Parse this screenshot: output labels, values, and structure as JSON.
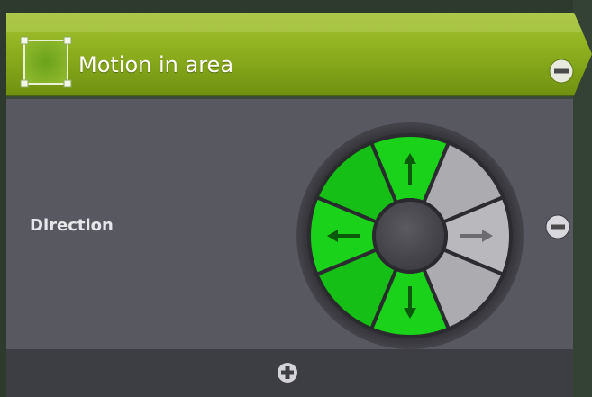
{
  "header": {
    "title": "Motion in area",
    "icon": "area-selection-icon",
    "accent": "#8cb01a"
  },
  "condition": {
    "label": "Direction",
    "dial": {
      "sectors_clockwise_from_top": [
        {
          "direction": "up",
          "selected": true,
          "arrow": "up-arrow-icon"
        },
        {
          "direction": "up-right",
          "selected": false
        },
        {
          "direction": "right",
          "selected": false,
          "arrow": "right-arrow-icon"
        },
        {
          "direction": "down-right",
          "selected": false
        },
        {
          "direction": "down",
          "selected": true,
          "arrow": "down-arrow-icon"
        },
        {
          "direction": "down-left",
          "selected": true
        },
        {
          "direction": "left",
          "selected": true,
          "arrow": "left-arrow-icon"
        },
        {
          "direction": "up-left",
          "selected": true
        }
      ],
      "selected_color": "#19d219",
      "unselected_color": "#b9b9bd"
    }
  },
  "buttons": {
    "collapse": "minus-icon",
    "remove_condition": "minus-icon",
    "add_condition": "plus-icon"
  },
  "colors": {
    "panel": "#585860",
    "footer": "#3d3d44",
    "header": "#8cb01a"
  }
}
